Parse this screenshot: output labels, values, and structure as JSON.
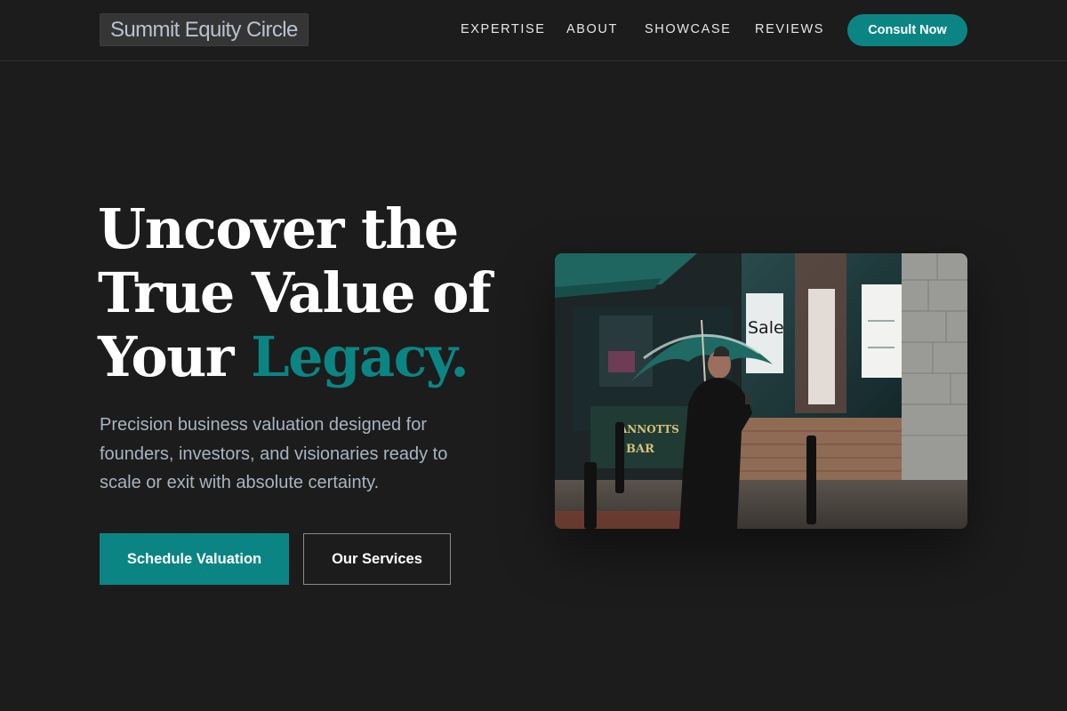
{
  "header": {
    "logo_text": "Summit Equity Circle",
    "nav": [
      "EXPERTISE",
      "ABOUT",
      "SHOWCASE",
      "REVIEWS"
    ],
    "cta_label": "Consult Now"
  },
  "hero": {
    "title_line1": "Uncover the",
    "title_line2": "True Value of",
    "title_line3_plain": "Your ",
    "title_line3_accent": "Legacy.",
    "subtitle": "Precision business valuation designed for founders, investors, and visionaries ready to scale or exit with absolute certainty.",
    "primary_button": "Schedule Valuation",
    "secondary_button": "Our Services",
    "image": {
      "sale_sign": "Sale",
      "bar_sign_line1": "ANNOTTS",
      "bar_sign_line2": "BAR"
    }
  },
  "colors": {
    "background": "#1c1c1c",
    "accent": "#0b8584",
    "subtitle_text": "#a9b4c2"
  }
}
